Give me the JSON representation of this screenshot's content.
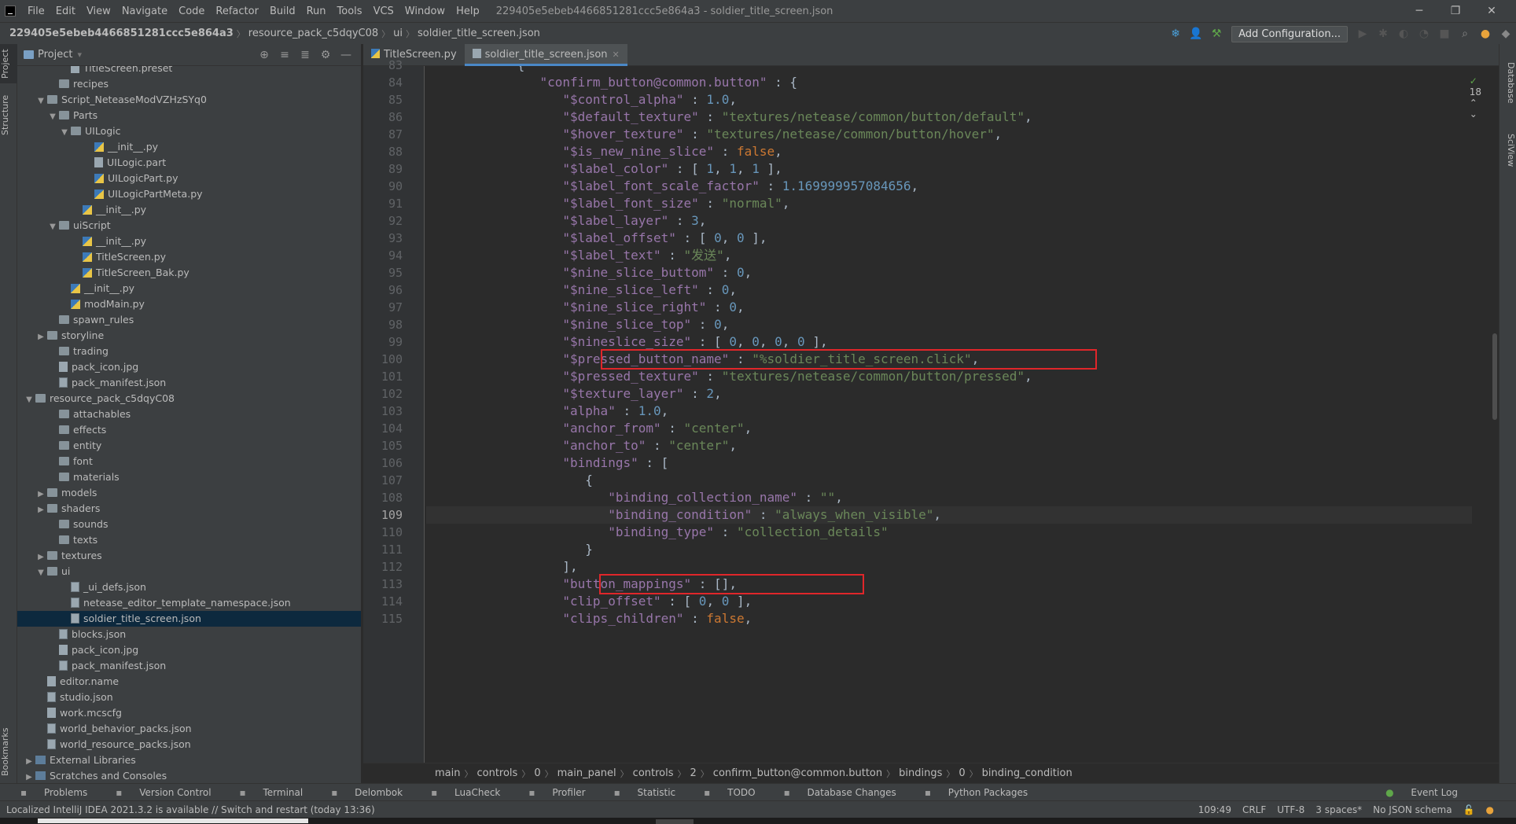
{
  "menubar": {
    "items": [
      "File",
      "Edit",
      "View",
      "Navigate",
      "Code",
      "Refactor",
      "Build",
      "Run",
      "Tools",
      "VCS",
      "Window",
      "Help"
    ],
    "window_title": "229405e5ebeb4466851281ccc5e864a3 - soldier_title_screen.json"
  },
  "navbar": {
    "crumbs": [
      "229405e5ebeb4466851281ccc5e864a3",
      "resource_pack_c5dqyC08",
      "ui",
      "soldier_title_screen.json"
    ],
    "add_config": "Add Configuration..."
  },
  "side_tabs": {
    "project": "Project",
    "structure": "Structure",
    "bookmarks": "Bookmarks",
    "database": "Database",
    "sciview": "SciView"
  },
  "project": {
    "title": "Project",
    "tree": [
      {
        "label": "TitleScreen.preset",
        "depth": 4,
        "type": "file",
        "arrow": ""
      },
      {
        "label": "recipes",
        "depth": 3,
        "type": "folder",
        "arrow": ""
      },
      {
        "label": "Script_NeteaseModVZHzSYq0",
        "depth": 2,
        "type": "folder",
        "arrow": "v"
      },
      {
        "label": "Parts",
        "depth": 3,
        "type": "folder",
        "arrow": "v"
      },
      {
        "label": "UILogic",
        "depth": 4,
        "type": "folder",
        "arrow": "v"
      },
      {
        "label": "__init__.py",
        "depth": 6,
        "type": "py",
        "arrow": ""
      },
      {
        "label": "UILogic.part",
        "depth": 6,
        "type": "file",
        "arrow": ""
      },
      {
        "label": "UILogicPart.py",
        "depth": 6,
        "type": "py",
        "arrow": ""
      },
      {
        "label": "UILogicPartMeta.py",
        "depth": 6,
        "type": "py",
        "arrow": ""
      },
      {
        "label": "__init__.py",
        "depth": 5,
        "type": "py",
        "arrow": ""
      },
      {
        "label": "uiScript",
        "depth": 3,
        "type": "folder",
        "arrow": "v"
      },
      {
        "label": "__init__.py",
        "depth": 5,
        "type": "py",
        "arrow": ""
      },
      {
        "label": "TitleScreen.py",
        "depth": 5,
        "type": "py",
        "arrow": ""
      },
      {
        "label": "TitleScreen_Bak.py",
        "depth": 5,
        "type": "py",
        "arrow": ""
      },
      {
        "label": "__init__.py",
        "depth": 4,
        "type": "py",
        "arrow": ""
      },
      {
        "label": "modMain.py",
        "depth": 4,
        "type": "py",
        "arrow": ""
      },
      {
        "label": "spawn_rules",
        "depth": 3,
        "type": "folder",
        "arrow": ""
      },
      {
        "label": "storyline",
        "depth": 2,
        "type": "folder",
        "arrow": ">"
      },
      {
        "label": "trading",
        "depth": 3,
        "type": "folder",
        "arrow": ""
      },
      {
        "label": "pack_icon.jpg",
        "depth": 3,
        "type": "file",
        "arrow": ""
      },
      {
        "label": "pack_manifest.json",
        "depth": 3,
        "type": "json",
        "arrow": ""
      },
      {
        "label": "resource_pack_c5dqyC08",
        "depth": 1,
        "type": "folder",
        "arrow": "v"
      },
      {
        "label": "attachables",
        "depth": 3,
        "type": "folder",
        "arrow": ""
      },
      {
        "label": "effects",
        "depth": 3,
        "type": "folder",
        "arrow": ""
      },
      {
        "label": "entity",
        "depth": 3,
        "type": "folder",
        "arrow": ""
      },
      {
        "label": "font",
        "depth": 3,
        "type": "folder",
        "arrow": ""
      },
      {
        "label": "materials",
        "depth": 3,
        "type": "folder",
        "arrow": ""
      },
      {
        "label": "models",
        "depth": 2,
        "type": "folder",
        "arrow": ">"
      },
      {
        "label": "shaders",
        "depth": 2,
        "type": "folder",
        "arrow": ">"
      },
      {
        "label": "sounds",
        "depth": 3,
        "type": "folder",
        "arrow": ""
      },
      {
        "label": "texts",
        "depth": 3,
        "type": "folder",
        "arrow": ""
      },
      {
        "label": "textures",
        "depth": 2,
        "type": "folder",
        "arrow": ">"
      },
      {
        "label": "ui",
        "depth": 2,
        "type": "folder",
        "arrow": "v"
      },
      {
        "label": "_ui_defs.json",
        "depth": 4,
        "type": "json",
        "arrow": ""
      },
      {
        "label": "netease_editor_template_namespace.json",
        "depth": 4,
        "type": "json",
        "arrow": ""
      },
      {
        "label": "soldier_title_screen.json",
        "depth": 4,
        "type": "json",
        "arrow": "",
        "selected": true
      },
      {
        "label": "blocks.json",
        "depth": 3,
        "type": "json",
        "arrow": ""
      },
      {
        "label": "pack_icon.jpg",
        "depth": 3,
        "type": "file",
        "arrow": ""
      },
      {
        "label": "pack_manifest.json",
        "depth": 3,
        "type": "json",
        "arrow": ""
      },
      {
        "label": "editor.name",
        "depth": 2,
        "type": "file",
        "arrow": ""
      },
      {
        "label": "studio.json",
        "depth": 2,
        "type": "json",
        "arrow": ""
      },
      {
        "label": "work.mcscfg",
        "depth": 2,
        "type": "file",
        "arrow": ""
      },
      {
        "label": "world_behavior_packs.json",
        "depth": 2,
        "type": "json",
        "arrow": ""
      },
      {
        "label": "world_resource_packs.json",
        "depth": 2,
        "type": "json",
        "arrow": ""
      },
      {
        "label": "External Libraries",
        "depth": 1,
        "type": "lib",
        "arrow": ">"
      },
      {
        "label": "Scratches and Consoles",
        "depth": 1,
        "type": "lib",
        "arrow": ">"
      }
    ]
  },
  "editor": {
    "tabs": [
      {
        "label": "TitleScreen.py",
        "icon": "py",
        "active": false
      },
      {
        "label": "soldier_title_screen.json",
        "icon": "json",
        "active": true
      }
    ],
    "indicator": "18",
    "lines": [
      {
        "n": "83",
        "tokens": [
          [
            "p",
            "            {"
          ]
        ]
      },
      {
        "n": "84",
        "tokens": [
          [
            "p",
            "               "
          ],
          [
            "k",
            "\"confirm_button@common.button\""
          ],
          [
            "p",
            " : {"
          ]
        ]
      },
      {
        "n": "85",
        "tokens": [
          [
            "p",
            "                  "
          ],
          [
            "k",
            "\"$control_alpha\""
          ],
          [
            "p",
            " : "
          ],
          [
            "n",
            "1.0"
          ],
          [
            "p",
            ","
          ]
        ]
      },
      {
        "n": "86",
        "tokens": [
          [
            "p",
            "                  "
          ],
          [
            "k",
            "\"$default_texture\""
          ],
          [
            "p",
            " : "
          ],
          [
            "s",
            "\"textures/netease/common/button/default\""
          ],
          [
            "p",
            ","
          ]
        ]
      },
      {
        "n": "87",
        "tokens": [
          [
            "p",
            "                  "
          ],
          [
            "k",
            "\"$hover_texture\""
          ],
          [
            "p",
            " : "
          ],
          [
            "s",
            "\"textures/netease/common/button/hover\""
          ],
          [
            "p",
            ","
          ]
        ]
      },
      {
        "n": "88",
        "tokens": [
          [
            "p",
            "                  "
          ],
          [
            "k",
            "\"$is_new_nine_slice\""
          ],
          [
            "p",
            " : "
          ],
          [
            "b",
            "false"
          ],
          [
            "p",
            ","
          ]
        ]
      },
      {
        "n": "89",
        "tokens": [
          [
            "p",
            "                  "
          ],
          [
            "k",
            "\"$label_color\""
          ],
          [
            "p",
            " : [ "
          ],
          [
            "n",
            "1"
          ],
          [
            "p",
            ", "
          ],
          [
            "n",
            "1"
          ],
          [
            "p",
            ", "
          ],
          [
            "n",
            "1"
          ],
          [
            "p",
            " ],"
          ]
        ]
      },
      {
        "n": "90",
        "tokens": [
          [
            "p",
            "                  "
          ],
          [
            "k",
            "\"$label_font_scale_factor\""
          ],
          [
            "p",
            " : "
          ],
          [
            "n",
            "1.169999957084656"
          ],
          [
            "p",
            ","
          ]
        ]
      },
      {
        "n": "91",
        "tokens": [
          [
            "p",
            "                  "
          ],
          [
            "k",
            "\"$label_font_size\""
          ],
          [
            "p",
            " : "
          ],
          [
            "s",
            "\"normal\""
          ],
          [
            "p",
            ","
          ]
        ]
      },
      {
        "n": "92",
        "tokens": [
          [
            "p",
            "                  "
          ],
          [
            "k",
            "\"$label_layer\""
          ],
          [
            "p",
            " : "
          ],
          [
            "n",
            "3"
          ],
          [
            "p",
            ","
          ]
        ]
      },
      {
        "n": "93",
        "tokens": [
          [
            "p",
            "                  "
          ],
          [
            "k",
            "\"$label_offset\""
          ],
          [
            "p",
            " : [ "
          ],
          [
            "n",
            "0"
          ],
          [
            "p",
            ", "
          ],
          [
            "n",
            "0"
          ],
          [
            "p",
            " ],"
          ]
        ]
      },
      {
        "n": "94",
        "tokens": [
          [
            "p",
            "                  "
          ],
          [
            "k",
            "\"$label_text\""
          ],
          [
            "p",
            " : "
          ],
          [
            "s",
            "\"发送\""
          ],
          [
            "p",
            ","
          ]
        ]
      },
      {
        "n": "95",
        "tokens": [
          [
            "p",
            "                  "
          ],
          [
            "k",
            "\"$nine_slice_buttom\""
          ],
          [
            "p",
            " : "
          ],
          [
            "n",
            "0"
          ],
          [
            "p",
            ","
          ]
        ]
      },
      {
        "n": "96",
        "tokens": [
          [
            "p",
            "                  "
          ],
          [
            "k",
            "\"$nine_slice_left\""
          ],
          [
            "p",
            " : "
          ],
          [
            "n",
            "0"
          ],
          [
            "p",
            ","
          ]
        ]
      },
      {
        "n": "97",
        "tokens": [
          [
            "p",
            "                  "
          ],
          [
            "k",
            "\"$nine_slice_right\""
          ],
          [
            "p",
            " : "
          ],
          [
            "n",
            "0"
          ],
          [
            "p",
            ","
          ]
        ]
      },
      {
        "n": "98",
        "tokens": [
          [
            "p",
            "                  "
          ],
          [
            "k",
            "\"$nine_slice_top\""
          ],
          [
            "p",
            " : "
          ],
          [
            "n",
            "0"
          ],
          [
            "p",
            ","
          ]
        ]
      },
      {
        "n": "99",
        "tokens": [
          [
            "p",
            "                  "
          ],
          [
            "k",
            "\"$nineslice_size\""
          ],
          [
            "p",
            " : [ "
          ],
          [
            "n",
            "0"
          ],
          [
            "p",
            ", "
          ],
          [
            "n",
            "0"
          ],
          [
            "p",
            ", "
          ],
          [
            "n",
            "0"
          ],
          [
            "p",
            ", "
          ],
          [
            "n",
            "0"
          ],
          [
            "p",
            " ],"
          ]
        ]
      },
      {
        "n": "100",
        "tokens": [
          [
            "p",
            "                  "
          ],
          [
            "k",
            "\"$pressed_button_name\""
          ],
          [
            "p",
            " : "
          ],
          [
            "s",
            "\"%soldier_title_screen.click\""
          ],
          [
            "p",
            ","
          ]
        ]
      },
      {
        "n": "101",
        "tokens": [
          [
            "p",
            "                  "
          ],
          [
            "k",
            "\"$pressed_texture\""
          ],
          [
            "p",
            " : "
          ],
          [
            "s",
            "\"textures/netease/common/button/pressed\""
          ],
          [
            "p",
            ","
          ]
        ]
      },
      {
        "n": "102",
        "tokens": [
          [
            "p",
            "                  "
          ],
          [
            "k",
            "\"$texture_layer\""
          ],
          [
            "p",
            " : "
          ],
          [
            "n",
            "2"
          ],
          [
            "p",
            ","
          ]
        ]
      },
      {
        "n": "103",
        "tokens": [
          [
            "p",
            "                  "
          ],
          [
            "k",
            "\"alpha\""
          ],
          [
            "p",
            " : "
          ],
          [
            "n",
            "1.0"
          ],
          [
            "p",
            ","
          ]
        ]
      },
      {
        "n": "104",
        "tokens": [
          [
            "p",
            "                  "
          ],
          [
            "k",
            "\"anchor_from\""
          ],
          [
            "p",
            " : "
          ],
          [
            "s",
            "\"center\""
          ],
          [
            "p",
            ","
          ]
        ]
      },
      {
        "n": "105",
        "tokens": [
          [
            "p",
            "                  "
          ],
          [
            "k",
            "\"anchor_to\""
          ],
          [
            "p",
            " : "
          ],
          [
            "s",
            "\"center\""
          ],
          [
            "p",
            ","
          ]
        ]
      },
      {
        "n": "106",
        "tokens": [
          [
            "p",
            "                  "
          ],
          [
            "k",
            "\"bindings\""
          ],
          [
            "p",
            " : ["
          ]
        ]
      },
      {
        "n": "107",
        "tokens": [
          [
            "p",
            "                     {"
          ]
        ]
      },
      {
        "n": "108",
        "tokens": [
          [
            "p",
            "                        "
          ],
          [
            "k",
            "\"binding_collection_name\""
          ],
          [
            "p",
            " : "
          ],
          [
            "s",
            "\"\""
          ],
          [
            "p",
            ","
          ]
        ]
      },
      {
        "n": "109",
        "tokens": [
          [
            "p",
            "                        "
          ],
          [
            "k",
            "\"binding_condition\""
          ],
          [
            "p",
            " : "
          ],
          [
            "s",
            "\"always_when_visible\""
          ],
          [
            "p",
            ","
          ]
        ]
      },
      {
        "n": "110",
        "tokens": [
          [
            "p",
            "                        "
          ],
          [
            "k",
            "\"binding_type\""
          ],
          [
            "p",
            " : "
          ],
          [
            "s",
            "\"collection_details\""
          ]
        ]
      },
      {
        "n": "111",
        "tokens": [
          [
            "p",
            "                     }"
          ]
        ]
      },
      {
        "n": "112",
        "tokens": [
          [
            "p",
            "                  ],"
          ]
        ]
      },
      {
        "n": "113",
        "tokens": [
          [
            "p",
            "                  "
          ],
          [
            "k",
            "\"button_mappings\""
          ],
          [
            "p",
            " : [],"
          ]
        ]
      },
      {
        "n": "114",
        "tokens": [
          [
            "p",
            "                  "
          ],
          [
            "k",
            "\"clip_offset\""
          ],
          [
            "p",
            " : [ "
          ],
          [
            "n",
            "0"
          ],
          [
            "p",
            ", "
          ],
          [
            "n",
            "0"
          ],
          [
            "p",
            " ],"
          ]
        ]
      },
      {
        "n": "115",
        "tokens": [
          [
            "p",
            "                  "
          ],
          [
            "k",
            "\"clips_children\""
          ],
          [
            "p",
            " : "
          ],
          [
            "b",
            "false"
          ],
          [
            "p",
            ","
          ]
        ]
      }
    ],
    "current_line": "109",
    "breadcrumb": [
      "main",
      "controls",
      "0",
      "main_panel",
      "controls",
      "2",
      "confirm_button@common.button",
      "bindings",
      "0",
      "binding_condition"
    ]
  },
  "toolwindows": [
    "Problems",
    "Version Control",
    "Terminal",
    "Delombok",
    "LuaCheck",
    "Profiler",
    "Statistic",
    "TODO",
    "Database Changes",
    "Python Packages"
  ],
  "event_log": "Event Log",
  "status": {
    "message": "Localized IntelliJ IDEA 2021.3.2 is available // Switch and restart (today 13:36)",
    "position": "109:49",
    "line_sep": "CRLF",
    "encoding": "UTF-8",
    "indent": "3 spaces*",
    "schema": "No JSON schema"
  },
  "colors": {
    "highlight_box": "#e0262a",
    "key": "#9876aa",
    "string": "#6a8759",
    "number": "#6897bb",
    "keyword": "#cc7832"
  }
}
